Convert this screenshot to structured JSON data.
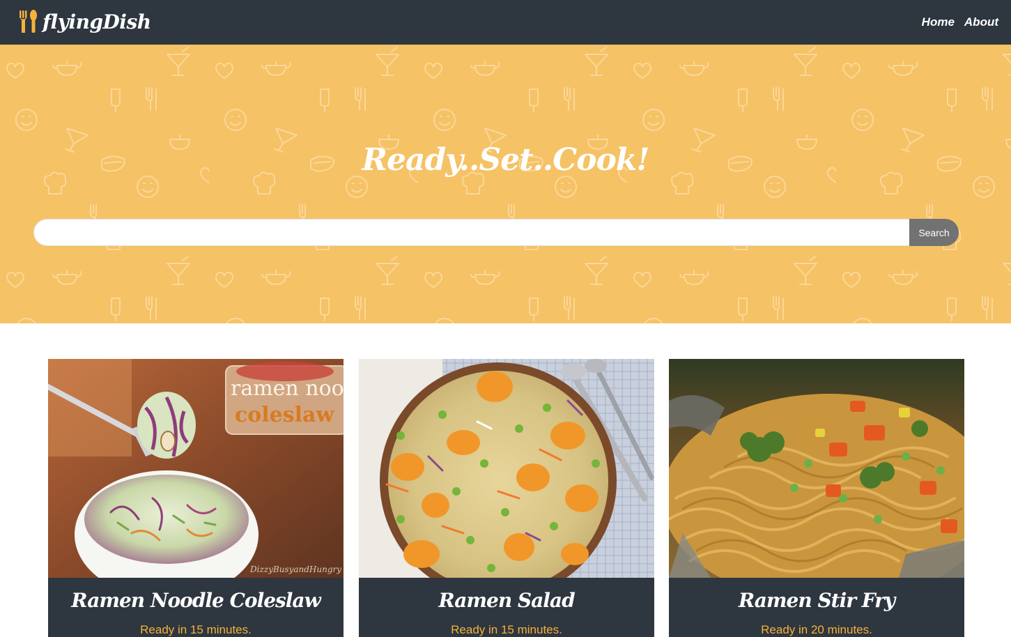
{
  "header": {
    "brand": "flyingDish",
    "nav": [
      {
        "label": "Home"
      },
      {
        "label": "About"
      }
    ]
  },
  "hero": {
    "title": "Ready..Set..Cook!",
    "search": {
      "placeholder": "",
      "value": "",
      "button_label": "Search"
    }
  },
  "recipes": [
    {
      "title": "Ramen Noodle Coleslaw",
      "ready_text": "Ready in 15 minutes.",
      "image_caption": "ramen noodl coleslaw",
      "watermark": "DizzyBusyandHungry"
    },
    {
      "title": "Ramen Salad",
      "ready_text": "Ready in 15 minutes."
    },
    {
      "title": "Ramen Stir Fry",
      "ready_text": "Ready in 20 minutes."
    }
  ],
  "colors": {
    "navbar": "#2e3640",
    "hero": "#f5c265",
    "accent": "#f5b23a",
    "search_button": "#727272"
  },
  "icons": {
    "brand": "fork-spoon-icon"
  }
}
